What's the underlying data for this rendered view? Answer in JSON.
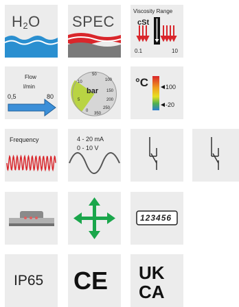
{
  "tiles": {
    "h2o": {
      "text_main": "H",
      "text_sub": "2",
      "text_end": "O"
    },
    "spec": {
      "label": "SPEC"
    },
    "viscosity": {
      "title": "Viscosity Range",
      "unit": "cSt",
      "min": "0.1",
      "max": "10"
    },
    "flow": {
      "title": "Flow",
      "unit": "l/min",
      "min": "0,5",
      "max": "80"
    },
    "pressure": {
      "unit": "bar",
      "ticks": [
        "10",
        "50",
        "100",
        "150",
        "200",
        "250",
        "350",
        "0",
        "5"
      ]
    },
    "temperature": {
      "unit": "°C",
      "high": "100",
      "low": "-20"
    },
    "frequency": {
      "label": "Frequency"
    },
    "output": {
      "line1": "4 - 20 mA",
      "line2": "0 - 10  V"
    },
    "counter": {
      "value": "123456"
    },
    "ip": {
      "label": "IP65"
    },
    "ce": {
      "label": "CE"
    },
    "ukca": {
      "line1": "UK",
      "line2": "CA"
    }
  },
  "colors": {
    "tile_bg": "#ececec",
    "water_blue": "#2a8fd0",
    "red": "#d9262b",
    "green": "#1aa64b",
    "arrow_blue": "#3b8fd8"
  }
}
